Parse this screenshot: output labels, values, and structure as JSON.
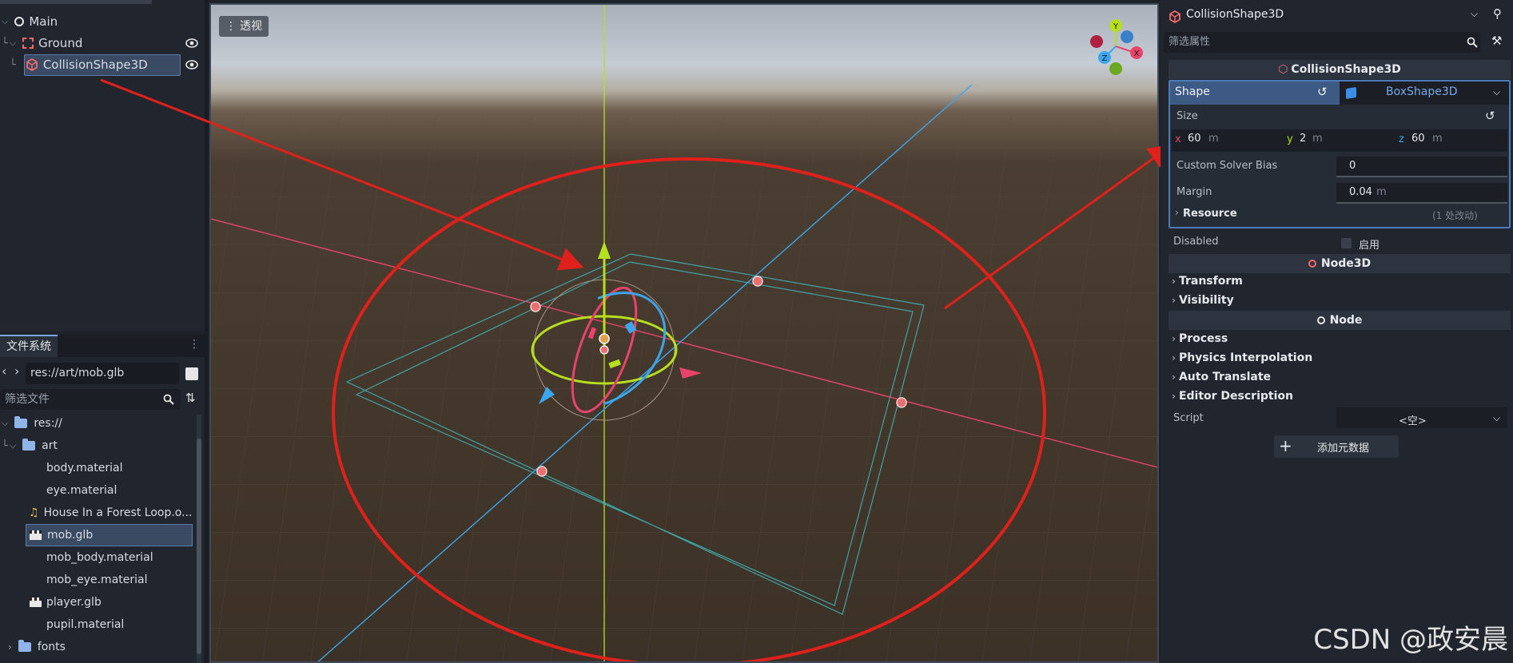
{
  "scene_tree": {
    "nodes": [
      {
        "label": "Main",
        "icon": "node-circle-icon"
      },
      {
        "label": "Ground",
        "icon": "static-body-icon"
      },
      {
        "label": "CollisionShape3D",
        "icon": "collision-shape-icon"
      }
    ]
  },
  "filesystem": {
    "tab_label": "文件系统",
    "path": "res://art/mob.glb",
    "filter_placeholder": "筛选文件",
    "items": [
      {
        "label": "res://",
        "type": "folder"
      },
      {
        "label": "art",
        "type": "folder"
      },
      {
        "label": "body.material",
        "type": "material"
      },
      {
        "label": "eye.material",
        "type": "material"
      },
      {
        "label": "House In a Forest Loop.o...",
        "type": "audio"
      },
      {
        "label": "mob.glb",
        "type": "scene"
      },
      {
        "label": "mob_body.material",
        "type": "material"
      },
      {
        "label": "mob_eye.material",
        "type": "material"
      },
      {
        "label": "player.glb",
        "type": "scene"
      },
      {
        "label": "pupil.material",
        "type": "material"
      },
      {
        "label": "fonts",
        "type": "folder"
      }
    ]
  },
  "viewport": {
    "perspective_label": "透视",
    "gizmo_axes": [
      "Y",
      "X",
      "Z"
    ]
  },
  "inspector": {
    "node_title": "CollisionShape3D",
    "filter_placeholder": "筛选属性",
    "class_header": "CollisionShape3D",
    "shape_label": "Shape",
    "shape_value": "BoxShape3D",
    "size_label": "Size",
    "size": {
      "x": "60",
      "y": "2",
      "z": "60",
      "unit": "m"
    },
    "custom_solver_bias_label": "Custom Solver Bias",
    "custom_solver_bias_value": "0",
    "margin_label": "Margin",
    "margin_value": "0.04",
    "margin_unit": "m",
    "resource_label": "Resource",
    "resource_changes": "(1 处改动)",
    "disabled_label": "Disabled",
    "disabled_value": "启用",
    "node3d_header": "Node3D",
    "node3d_groups": [
      "Transform",
      "Visibility"
    ],
    "node_header": "Node",
    "node_groups": [
      "Process",
      "Physics Interpolation",
      "Auto Translate",
      "Editor Description"
    ],
    "script_label": "Script",
    "script_value": "<空>",
    "add_metadata_label": "添加元数据"
  },
  "watermark": "CSDN @政安晨",
  "colors": {
    "accent": "#7aa8e8",
    "annotation": "#e0201a",
    "axis_x": "#e8446a",
    "axis_y": "#b6e01e",
    "axis_z": "#3ba6ee"
  }
}
